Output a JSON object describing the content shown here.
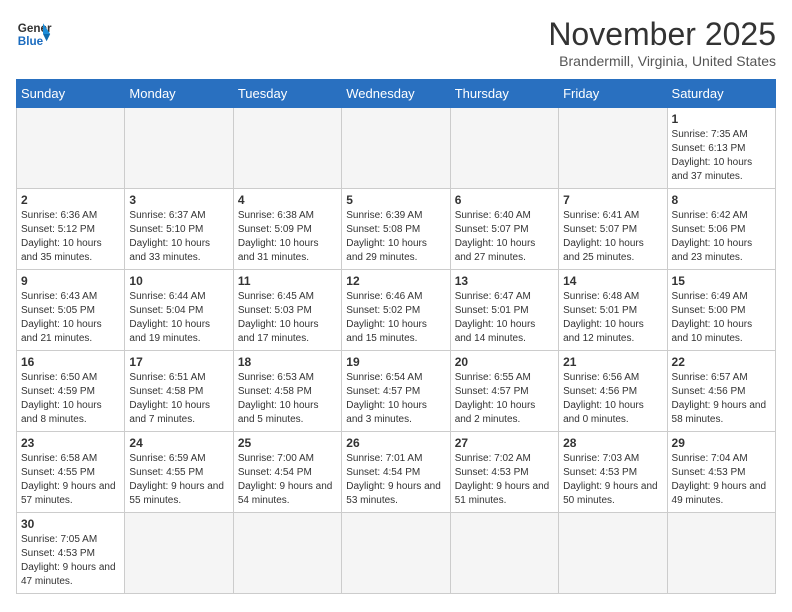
{
  "header": {
    "logo_general": "General",
    "logo_blue": "Blue",
    "month_title": "November 2025",
    "location": "Brandermill, Virginia, United States"
  },
  "weekdays": [
    "Sunday",
    "Monday",
    "Tuesday",
    "Wednesday",
    "Thursday",
    "Friday",
    "Saturday"
  ],
  "weeks": [
    [
      {
        "day": "",
        "info": ""
      },
      {
        "day": "",
        "info": ""
      },
      {
        "day": "",
        "info": ""
      },
      {
        "day": "",
        "info": ""
      },
      {
        "day": "",
        "info": ""
      },
      {
        "day": "",
        "info": ""
      },
      {
        "day": "1",
        "info": "Sunrise: 7:35 AM\nSunset: 6:13 PM\nDaylight: 10 hours and 37 minutes."
      }
    ],
    [
      {
        "day": "2",
        "info": "Sunrise: 6:36 AM\nSunset: 5:12 PM\nDaylight: 10 hours and 35 minutes."
      },
      {
        "day": "3",
        "info": "Sunrise: 6:37 AM\nSunset: 5:10 PM\nDaylight: 10 hours and 33 minutes."
      },
      {
        "day": "4",
        "info": "Sunrise: 6:38 AM\nSunset: 5:09 PM\nDaylight: 10 hours and 31 minutes."
      },
      {
        "day": "5",
        "info": "Sunrise: 6:39 AM\nSunset: 5:08 PM\nDaylight: 10 hours and 29 minutes."
      },
      {
        "day": "6",
        "info": "Sunrise: 6:40 AM\nSunset: 5:07 PM\nDaylight: 10 hours and 27 minutes."
      },
      {
        "day": "7",
        "info": "Sunrise: 6:41 AM\nSunset: 5:07 PM\nDaylight: 10 hours and 25 minutes."
      },
      {
        "day": "8",
        "info": "Sunrise: 6:42 AM\nSunset: 5:06 PM\nDaylight: 10 hours and 23 minutes."
      }
    ],
    [
      {
        "day": "9",
        "info": "Sunrise: 6:43 AM\nSunset: 5:05 PM\nDaylight: 10 hours and 21 minutes."
      },
      {
        "day": "10",
        "info": "Sunrise: 6:44 AM\nSunset: 5:04 PM\nDaylight: 10 hours and 19 minutes."
      },
      {
        "day": "11",
        "info": "Sunrise: 6:45 AM\nSunset: 5:03 PM\nDaylight: 10 hours and 17 minutes."
      },
      {
        "day": "12",
        "info": "Sunrise: 6:46 AM\nSunset: 5:02 PM\nDaylight: 10 hours and 15 minutes."
      },
      {
        "day": "13",
        "info": "Sunrise: 6:47 AM\nSunset: 5:01 PM\nDaylight: 10 hours and 14 minutes."
      },
      {
        "day": "14",
        "info": "Sunrise: 6:48 AM\nSunset: 5:01 PM\nDaylight: 10 hours and 12 minutes."
      },
      {
        "day": "15",
        "info": "Sunrise: 6:49 AM\nSunset: 5:00 PM\nDaylight: 10 hours and 10 minutes."
      }
    ],
    [
      {
        "day": "16",
        "info": "Sunrise: 6:50 AM\nSunset: 4:59 PM\nDaylight: 10 hours and 8 minutes."
      },
      {
        "day": "17",
        "info": "Sunrise: 6:51 AM\nSunset: 4:58 PM\nDaylight: 10 hours and 7 minutes."
      },
      {
        "day": "18",
        "info": "Sunrise: 6:53 AM\nSunset: 4:58 PM\nDaylight: 10 hours and 5 minutes."
      },
      {
        "day": "19",
        "info": "Sunrise: 6:54 AM\nSunset: 4:57 PM\nDaylight: 10 hours and 3 minutes."
      },
      {
        "day": "20",
        "info": "Sunrise: 6:55 AM\nSunset: 4:57 PM\nDaylight: 10 hours and 2 minutes."
      },
      {
        "day": "21",
        "info": "Sunrise: 6:56 AM\nSunset: 4:56 PM\nDaylight: 10 hours and 0 minutes."
      },
      {
        "day": "22",
        "info": "Sunrise: 6:57 AM\nSunset: 4:56 PM\nDaylight: 9 hours and 58 minutes."
      }
    ],
    [
      {
        "day": "23",
        "info": "Sunrise: 6:58 AM\nSunset: 4:55 PM\nDaylight: 9 hours and 57 minutes."
      },
      {
        "day": "24",
        "info": "Sunrise: 6:59 AM\nSunset: 4:55 PM\nDaylight: 9 hours and 55 minutes."
      },
      {
        "day": "25",
        "info": "Sunrise: 7:00 AM\nSunset: 4:54 PM\nDaylight: 9 hours and 54 minutes."
      },
      {
        "day": "26",
        "info": "Sunrise: 7:01 AM\nSunset: 4:54 PM\nDaylight: 9 hours and 53 minutes."
      },
      {
        "day": "27",
        "info": "Sunrise: 7:02 AM\nSunset: 4:53 PM\nDaylight: 9 hours and 51 minutes."
      },
      {
        "day": "28",
        "info": "Sunrise: 7:03 AM\nSunset: 4:53 PM\nDaylight: 9 hours and 50 minutes."
      },
      {
        "day": "29",
        "info": "Sunrise: 7:04 AM\nSunset: 4:53 PM\nDaylight: 9 hours and 49 minutes."
      }
    ],
    [
      {
        "day": "30",
        "info": "Sunrise: 7:05 AM\nSunset: 4:53 PM\nDaylight: 9 hours and 47 minutes."
      },
      {
        "day": "",
        "info": ""
      },
      {
        "day": "",
        "info": ""
      },
      {
        "day": "",
        "info": ""
      },
      {
        "day": "",
        "info": ""
      },
      {
        "day": "",
        "info": ""
      },
      {
        "day": "",
        "info": ""
      }
    ]
  ]
}
